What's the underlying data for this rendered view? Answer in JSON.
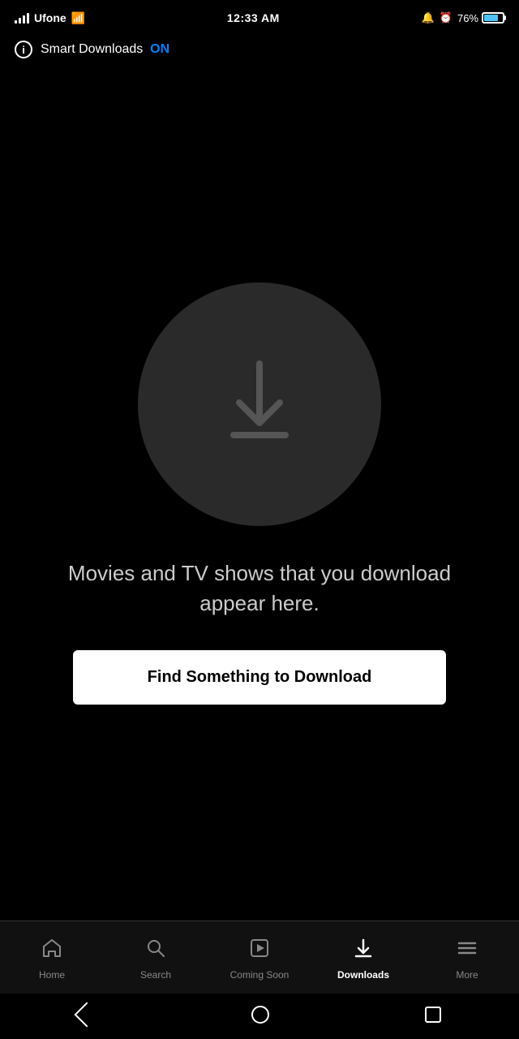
{
  "statusBar": {
    "carrier": "Ufone",
    "time": "12:33 AM",
    "battery": "76%",
    "batteryLevel": 76
  },
  "smartDownloads": {
    "label": "Smart Downloads",
    "status": "ON"
  },
  "main": {
    "emptyText": "Movies and TV shows that you download appear here.",
    "findButtonLabel": "Find Something to Download"
  },
  "bottomNav": {
    "items": [
      {
        "id": "home",
        "label": "Home",
        "icon": "house",
        "active": false
      },
      {
        "id": "search",
        "label": "Search",
        "icon": "search",
        "active": false
      },
      {
        "id": "coming-soon",
        "label": "Coming Soon",
        "icon": "play-box",
        "active": false
      },
      {
        "id": "downloads",
        "label": "Downloads",
        "icon": "download",
        "active": true
      },
      {
        "id": "more",
        "label": "More",
        "icon": "menu",
        "active": false
      }
    ]
  }
}
